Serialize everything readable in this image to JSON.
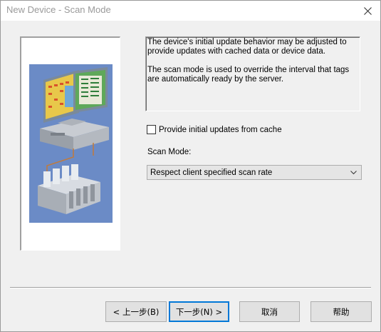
{
  "window": {
    "title": "New Device - Scan Mode"
  },
  "description": {
    "paragraph1": "The device's initial update behavior may be adjusted to provide updates with cached data or device data.",
    "paragraph2": "The scan mode is used to override the interval that tags are automatically ready by the server."
  },
  "options": {
    "initial_updates_label": "Provide initial updates from cache",
    "initial_updates_checked": false,
    "scan_mode_label": "Scan Mode:",
    "scan_mode_value": "Respect client specified scan rate"
  },
  "buttons": {
    "back": "< 上一步(B)",
    "next": "下一步(N) >",
    "cancel": "取消",
    "help": "帮助"
  },
  "colors": {
    "illustration_bg": "#6b8bc6",
    "accent_focus": "#0078d7"
  }
}
